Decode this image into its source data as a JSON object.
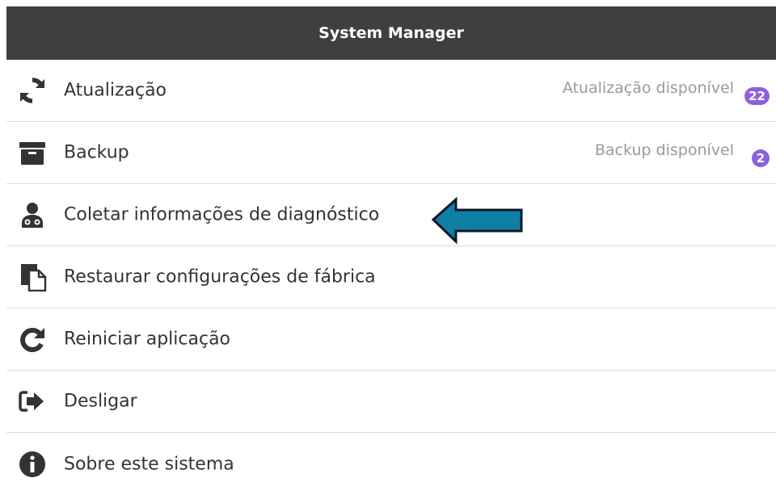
{
  "title": "System Manager",
  "items": [
    {
      "label": "Atualização",
      "icon": "refresh-icon",
      "status": "Atualização disponível",
      "badge": "22"
    },
    {
      "label": "Backup",
      "icon": "archive-box-icon",
      "status": "Backup disponível",
      "badge": "2"
    },
    {
      "label": "Coletar informações de diagnóstico",
      "icon": "doctor-icon"
    },
    {
      "label": "Restaurar configurações de fábrica",
      "icon": "documents-icon"
    },
    {
      "label": "Reiniciar aplicação",
      "icon": "restart-icon"
    },
    {
      "label": "Desligar",
      "icon": "sign-out-icon"
    },
    {
      "label": "Sobre este sistema",
      "icon": "info-icon"
    }
  ],
  "colors": {
    "titlebar_bg": "#3f3f3f",
    "badge_bg": "#8a62e0",
    "arrow_fill": "#0f7fa3",
    "arrow_stroke": "#0b1a2a"
  }
}
